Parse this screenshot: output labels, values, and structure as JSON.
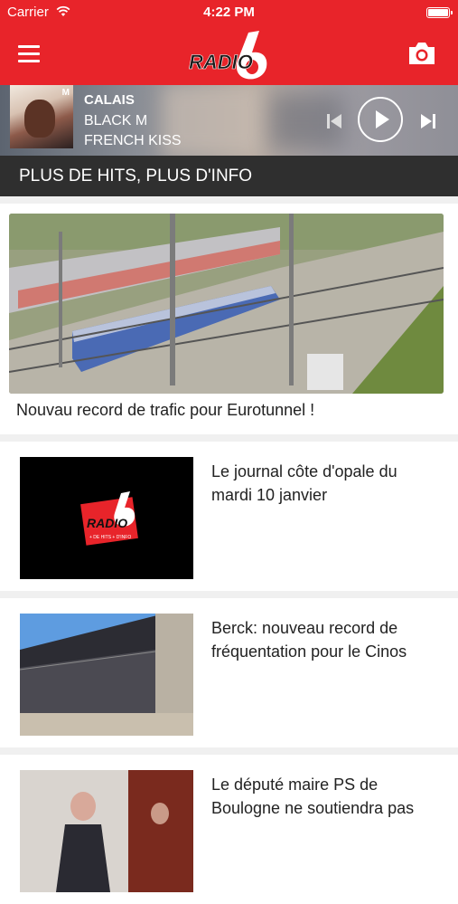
{
  "status_bar": {
    "carrier": "Carrier",
    "time": "4:22 PM"
  },
  "nav": {
    "menu_icon": "hamburger-icon",
    "logo_text": "RADIO",
    "logo_number": "6",
    "camera_icon": "camera-icon",
    "brand_color": "#e8242a"
  },
  "player": {
    "station": "CALAIS",
    "artist": "BLACK M",
    "title": "FRENCH KISS",
    "cover_badge": "M",
    "controls": {
      "prev_icon": "skip-previous-icon",
      "play_icon": "play-icon",
      "next_icon": "skip-next-icon"
    }
  },
  "tagline": "PLUS DE HITS, PLUS D'INFO",
  "featured": {
    "title": "Nouvau record de trafic pour Eurotunnel !",
    "image": "train-photo"
  },
  "articles": [
    {
      "title": "Le journal côte d'opale du mardi 10 janvier",
      "image": "radio6-logo-thumb",
      "thumb_logo": "RADIO",
      "thumb_number": "6",
      "thumb_slogan": "+ DE HITS + D'INFO"
    },
    {
      "title": "Berck: nouveau record de fréquentation pour le Cinos",
      "image": "building-photo"
    },
    {
      "title": "Le député maire PS de Boulogne ne soutiendra pas",
      "image": "people-photo"
    }
  ]
}
